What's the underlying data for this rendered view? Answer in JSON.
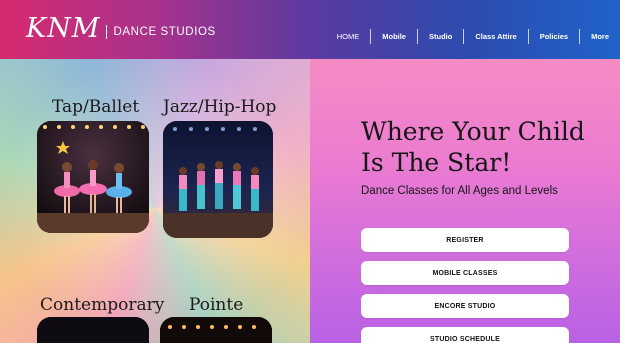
{
  "header": {
    "logo_text": "KNM",
    "logo_subtitle": "DANCE STUDIOS",
    "nav": [
      {
        "label": "HOME"
      },
      {
        "label": "Mobile"
      },
      {
        "label": "Studio"
      },
      {
        "label": "Class Attire"
      },
      {
        "label": "Policies"
      },
      {
        "label": "More"
      }
    ]
  },
  "categories": [
    {
      "label": "Tap/Ballet",
      "image": "tap-ballet-photo"
    },
    {
      "label": "Jazz/Hip-Hop",
      "image": "jazz-hip-hop-photo"
    },
    {
      "label": "Contemporary",
      "image": "contemporary-photo"
    },
    {
      "label": "Pointe",
      "image": "pointe-photo"
    }
  ],
  "hero": {
    "headline": "Where Your Child Is The Star!",
    "subheadline": "Dance Classes for All Ages and Levels"
  },
  "buttons": [
    {
      "label": "REGISTER"
    },
    {
      "label": "MOBILE CLASSES"
    },
    {
      "label": "ENCORE STUDIO"
    },
    {
      "label": "STUDIO SCHEDULE"
    }
  ],
  "colors": {
    "header_start": "#d62a6e",
    "header_end": "#1f63c8",
    "right_panel_top": "#f58cc4",
    "right_panel_bottom": "#b961e4"
  }
}
